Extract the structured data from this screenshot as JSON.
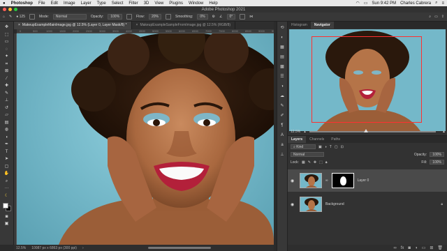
{
  "menubar": {
    "app": "Photoshop",
    "items": [
      "File",
      "Edit",
      "Image",
      "Layer",
      "Type",
      "Select",
      "Filter",
      "3D",
      "View",
      "Plugins",
      "Window",
      "Help"
    ],
    "clock": "Sun 9:42 PM",
    "user": "Charles Cabrera"
  },
  "window": {
    "title": "Adobe Photoshop 2021"
  },
  "options": {
    "brush_size": "125",
    "mode_label": "Mode:",
    "mode_value": "Normal",
    "opacity_label": "Opacity:",
    "opacity_value": "100%",
    "flow_label": "Flow:",
    "flow_value": "20%",
    "smoothing_label": "Smoothing:",
    "smoothing_value": "0%",
    "angle_value": "0°"
  },
  "doc_tabs": [
    {
      "label": "MakeupExampleMainImage.jpg @ 12.5% (Layer 0, Layer Mask/8) *"
    },
    {
      "label": "MakeupExampleSampleFromImage.jpg @ 12.5% (RGB/8)"
    }
  ],
  "ruler_ticks": [
    "0",
    "500",
    "1000",
    "1500",
    "2000",
    "2500",
    "3000",
    "3500",
    "4000",
    "4500",
    "5000",
    "5500",
    "6000",
    "6500",
    "7000",
    "7500",
    "8000",
    "8500",
    "9000",
    "9500"
  ],
  "status": {
    "zoom": "12.5%",
    "doc_size": "10087 px x 6863 px (300 ppi)"
  },
  "navigator": {
    "tabs": [
      "Histogram",
      "Navigator"
    ],
    "zoom": "12.5%",
    "zoom_level": 0.45
  },
  "layers_panel": {
    "tabs": [
      "Layers",
      "Channels",
      "Paths"
    ],
    "filter_label": "Kind",
    "blend_mode": "Normal",
    "opacity_label": "Opacity:",
    "opacity_value": "100%",
    "lock_label": "Lock:",
    "fill_label": "Fill:",
    "fill_value": "100%",
    "layers": [
      {
        "name": "Layer 0",
        "selected": true
      },
      {
        "name": "Background",
        "selected": false
      }
    ]
  },
  "colors": {
    "accent": "#2d8ceb",
    "nav_rect": "#ff3030",
    "backdrop": "#72b7c9"
  }
}
